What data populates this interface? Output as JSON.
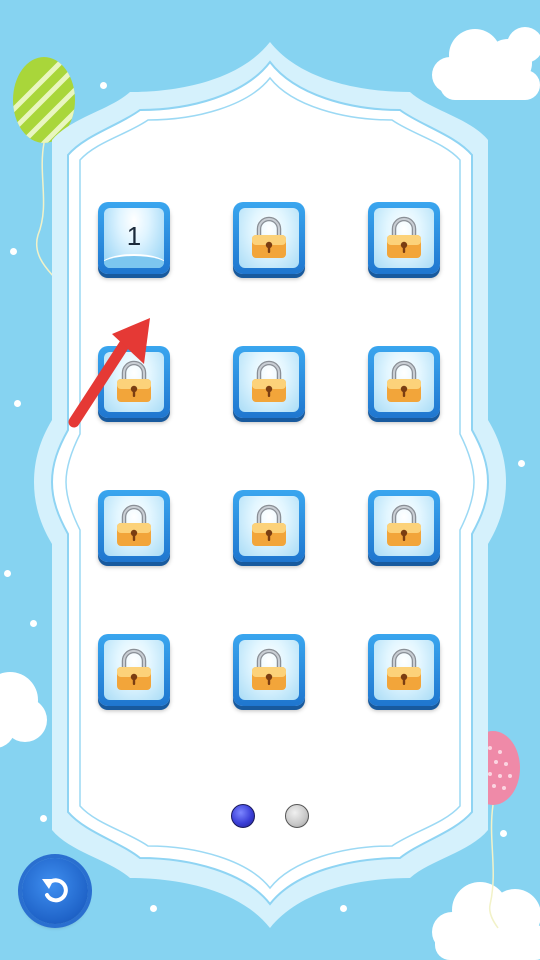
{
  "levels": [
    {
      "number": "1",
      "locked": false
    },
    {
      "number": "",
      "locked": true
    },
    {
      "number": "",
      "locked": true
    },
    {
      "number": "",
      "locked": true
    },
    {
      "number": "",
      "locked": true
    },
    {
      "number": "",
      "locked": true
    },
    {
      "number": "",
      "locked": true
    },
    {
      "number": "",
      "locked": true
    },
    {
      "number": "",
      "locked": true
    },
    {
      "number": "",
      "locked": true
    },
    {
      "number": "",
      "locked": true
    },
    {
      "number": "",
      "locked": true
    }
  ],
  "pagination": {
    "current_page": 1,
    "total_pages": 2
  },
  "icons": {
    "back": "back-arrow-icon",
    "lock": "padlock-icon",
    "hint": "red-arrow-pointer"
  },
  "colors": {
    "background": "#86d3f1",
    "panel": "#ffffff",
    "panel_border": "#bfe9fb",
    "tile": "#1f76cf",
    "hint_arrow": "#e53935"
  }
}
